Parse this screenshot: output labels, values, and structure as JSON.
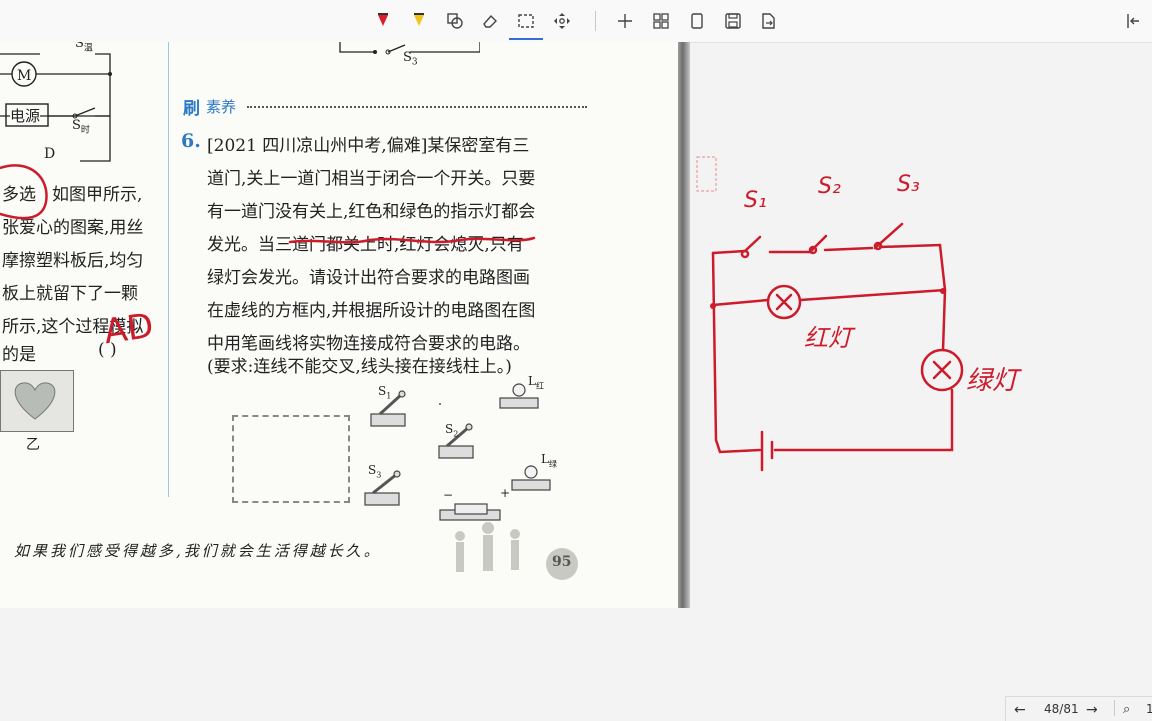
{
  "toolbar": {
    "tools": [
      "pen-red-icon",
      "highlighter-yellow-icon",
      "shape-icon",
      "eraser-icon",
      "lasso-select-icon",
      "pan-icon",
      "add-icon",
      "grid-icon",
      "page-icon",
      "save-icon",
      "export-icon",
      "collapse-icon"
    ]
  },
  "book": {
    "left_labels": {
      "s_heat": "S",
      "s_heat_sub": "温",
      "s_time": "S",
      "s_time_sub": "时",
      "power": "电源",
      "option_d": "D",
      "multi": "多选",
      "line1": "如图甲所示,",
      "line2": "张爱心的图案,用丝",
      "line3": "摩擦塑料板后,均匀",
      "line4": "板上就留下了一颗",
      "line5": "所示,这个过程模拟",
      "line6": "的是",
      "paren": "(     )",
      "fig_label": "乙",
      "handwritten_answer": "AD"
    },
    "s3_top": "S",
    "s3_top_sub": "3",
    "section_icon": "刷",
    "section_title": "素养",
    "q_number": "6.",
    "q_lines": [
      "[2021 四川凉山州中考,偏难]某保密室有三",
      "道门,关上一道门相当于闭合一个开关。只要",
      "有一道门没有关上,红色和绿色的指示灯都会",
      "发光。当三道门都关上时,红灯会熄灭,只有",
      "绿灯会发光。请设计出符合要求的电路图画",
      "在虚线的方框内,并根据所设计的电路图在图",
      "中用笔画线将实物连接成符合要求的电路。",
      "(要求:连线不能交叉,线头接在接线柱上。)"
    ],
    "components": {
      "s1": "S",
      "s1_sub": "1",
      "s2": "S",
      "s2_sub": "2",
      "s3": "S",
      "s3_sub": "3",
      "l_red": "L",
      "l_red_sub": "红",
      "l_green": "L",
      "l_green_sub": "绿",
      "minus": "−",
      "plus": "+"
    },
    "footer_quote": "如果我们感受得越多,我们就会生活得越长久。",
    "page_number": "95"
  },
  "ink": {
    "s1": "S₁",
    "s2": "S₂",
    "s3": "S₃",
    "red_lamp": "红灯",
    "green_lamp": "绿灯"
  },
  "status": {
    "page_indicator": "48/81",
    "zoom_partial": "1"
  },
  "colors": {
    "ink_red": "#cc1b2b",
    "accent_blue": "#2b7ac4"
  }
}
